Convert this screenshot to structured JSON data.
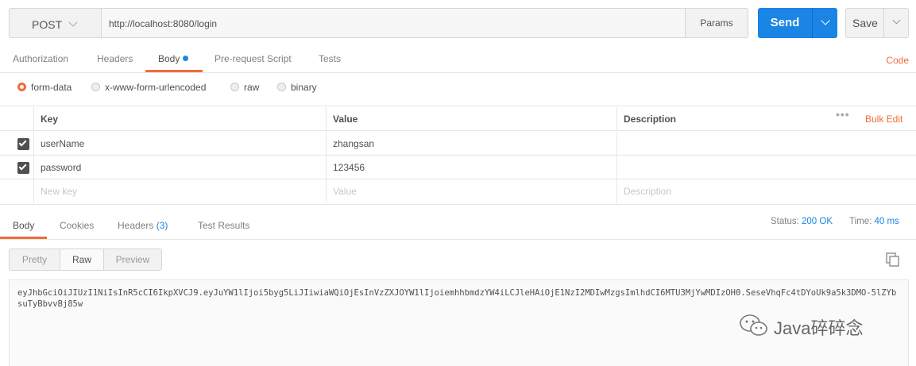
{
  "request": {
    "method": "POST",
    "url": "http://localhost:8080/login",
    "params_label": "Params",
    "send_label": "Send",
    "save_label": "Save"
  },
  "request_tabs": {
    "authorization": "Authorization",
    "headers": "Headers",
    "body": "Body",
    "pre_request": "Pre-request Script",
    "tests": "Tests",
    "code": "Code"
  },
  "body_types": {
    "form_data": "form-data",
    "urlencoded": "x-www-form-urlencoded",
    "raw": "raw",
    "binary": "binary"
  },
  "kv_table": {
    "headers": {
      "key": "Key",
      "value": "Value",
      "description": "Description"
    },
    "bulk_edit": "Bulk Edit",
    "rows": [
      {
        "key": "userName",
        "value": "zhangsan",
        "description": ""
      },
      {
        "key": "password",
        "value": "123456",
        "description": ""
      }
    ],
    "placeholders": {
      "key": "New key",
      "value": "Value",
      "description": "Description"
    }
  },
  "response": {
    "tabs": {
      "body": "Body",
      "cookies": "Cookies",
      "headers": "Headers",
      "headers_count": "(3)",
      "test_results": "Test Results"
    },
    "status_label": "Status:",
    "status_value": "200 OK",
    "time_label": "Time:",
    "time_value": "40 ms",
    "view_modes": {
      "pretty": "Pretty",
      "raw": "Raw",
      "preview": "Preview"
    },
    "body_text": "eyJhbGciOiJIUzI1NiIsInR5cCI6IkpXVCJ9.eyJuYW1lIjoi5byg5LiJIiwiaWQiOjEsInVzZXJOYW1lIjoiemhhbmdzYW4iLCJleHAiOjE1NzI2MDIwMzgsImlhdCI6MTU3MjYwMDIzOH0.SeseVhqFc4tDYoUk9a5k3DMO-5lZYbsuTyBbvvBj85w"
  },
  "watermark": {
    "text": "Java碎碎念"
  }
}
